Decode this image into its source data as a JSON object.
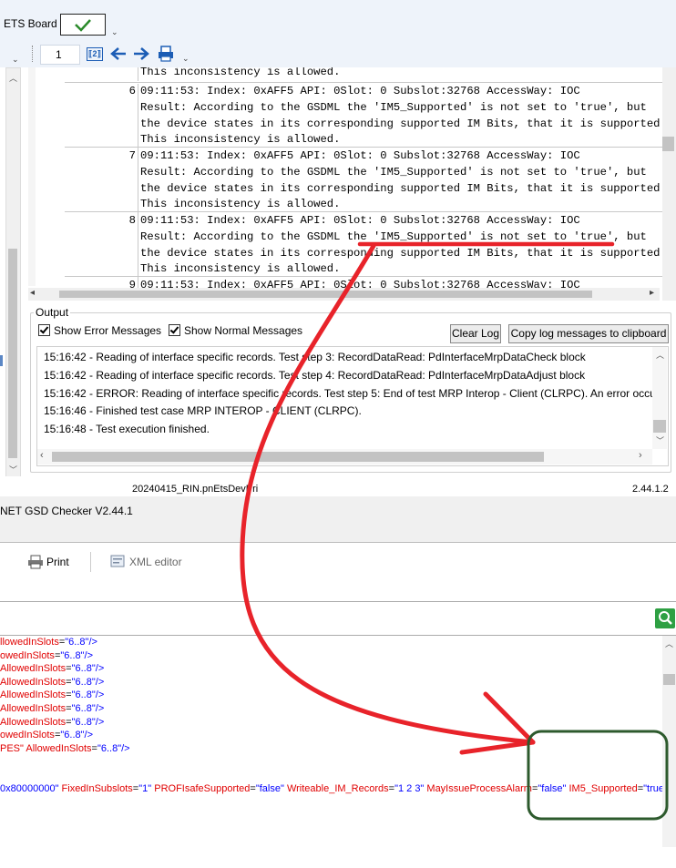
{
  "toolbar": {
    "ets_board_label": "ETS Board",
    "page_number": "1",
    "ok_mark": "✓"
  },
  "log": {
    "first_partial_line": "This inconsistency is allowed.",
    "entries": [
      {
        "num": "6",
        "lines": [
          "09:11:53: Index: 0xAFF5 API: 0Slot: 0 Subslot:32768 AccessWay: IOC",
          "Result: According to the GSDML the 'IM5_Supported' is not set to 'true', but",
          "the device states in its corresponding supported IM Bits, that it is supported",
          "This inconsistency is allowed."
        ]
      },
      {
        "num": "7",
        "lines": [
          "09:11:53: Index: 0xAFF5 API: 0Slot: 0 Subslot:32768 AccessWay: IOC",
          "Result: According to the GSDML the 'IM5_Supported' is not set to 'true', but",
          "the device states in its corresponding supported IM Bits, that it is supported",
          "This inconsistency is allowed."
        ]
      },
      {
        "num": "8",
        "lines": [
          "09:11:53: Index: 0xAFF5 API: 0Slot: 0 Subslot:32768 AccessWay: IOC",
          "Result: According to the GSDML the 'IM5_Supported' is not set to 'true', but",
          "the device states in its corresponding supported IM Bits, that it is supported",
          "This inconsistency is allowed."
        ]
      },
      {
        "num": "9",
        "lines": [
          "09:11:53: Index: 0xAFF5 API: 0Slot: 0 Subslot:32768 AccessWay: IOC"
        ]
      }
    ]
  },
  "output": {
    "group_label": "Output",
    "show_error_label": "Show Error Messages",
    "show_normal_label": "Show Normal Messages",
    "clear_log_label": "Clear Log",
    "copy_label": "Copy log messages to clipboard",
    "messages": [
      "15:16:42 - Reading of interface specific records. Test step 3: RecordDataRead: PdInterfaceMrpDataCheck block",
      "15:16:42 - Reading of interface specific records. Test step 4: RecordDataRead: PdInterfaceMrpDataAdjust block",
      "15:16:42 - ERROR: Reading of interface specific records. Test step 5: End of test MRP Interop - Client (CLRPC). An error occurred",
      "15:16:46 - Finished test case MRP INTEROP - CLIENT (CLRPC).",
      "15:16:48 - Test execution finished."
    ]
  },
  "status": {
    "file_name": "20240415_RIN.pnEtsDevPri",
    "version": "2.44.1.2"
  },
  "gsd_window": {
    "title": "NET GSD Checker V2.44.1",
    "print_label": "Print",
    "xml_editor_label": "XML editor"
  },
  "xml": {
    "lines": [
      {
        "attr": "llowedInSlots",
        "val": "\"6..8\""
      },
      {
        "attr": "owedInSlots",
        "val": "\"6..8\""
      },
      {
        "attr": " AllowedInSlots",
        "val": "\"6..8\""
      },
      {
        "attr": " AllowedInSlots",
        "val": "\"6..8\""
      },
      {
        "attr": "AllowedInSlots",
        "val": "\"6..8\""
      },
      {
        "attr": "AllowedInSlots",
        "val": "\"6..8\""
      },
      {
        "attr": "AllowedInSlots",
        "val": "\"6..8\""
      },
      {
        "attr": "owedInSlots",
        "val": "\"6..8\""
      },
      {
        "attr": "PES\" AllowedInSlots",
        "val": "\"6..8\""
      }
    ],
    "long_line": {
      "p0": "0x80000000\"",
      "a1": " FixedInSubslots",
      "v1": "\"1\"",
      "a2": " PROFIsafeSupported",
      "v2": "\"false\"",
      "a3": " Writeable_IM_Records",
      "v3": "\"1 2 3\"",
      "a4": " MayIssueProcessAlarm",
      "v4": "\"false\"",
      "a5": " IM5_Supported",
      "v5": "\"true\""
    }
  },
  "colors": {
    "annotation_red": "#e8232a",
    "annotation_box": "#2d5a2d",
    "xml_attr": "#e00000",
    "xml_value": "#0000ff"
  }
}
